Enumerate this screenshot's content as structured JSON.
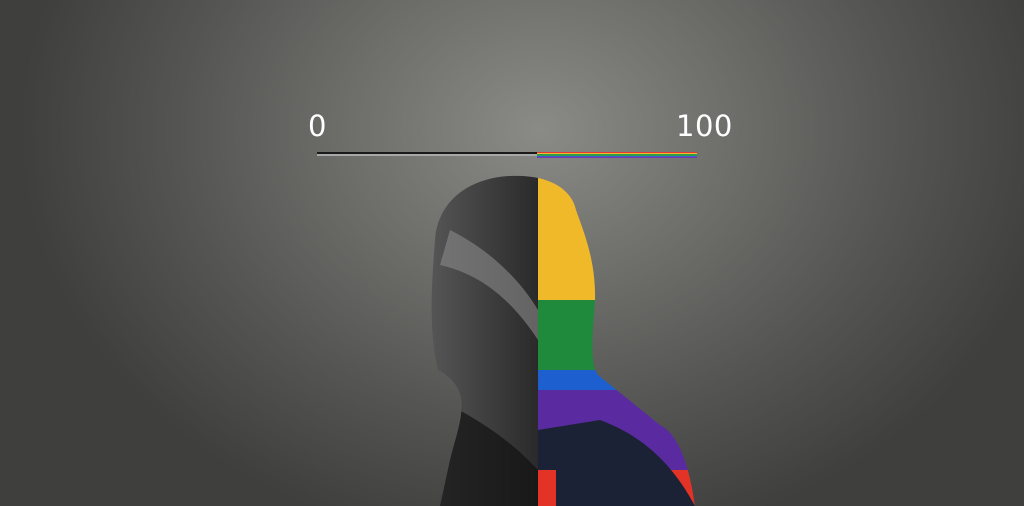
{
  "scale": {
    "min_label": "0",
    "max_label": "100",
    "value_percent": 58,
    "stripe_colors": [
      "#e53935",
      "#f5b82e",
      "#2e9d4a",
      "#3b5bd6",
      "#7b3aa8"
    ]
  },
  "figure": {
    "icon": "person-wrapped-in-rainbow-flag",
    "flag_colors": [
      "#f0b92a",
      "#1f8a3c",
      "#1e5fd0",
      "#5a2ba0",
      "#e23326"
    ]
  }
}
